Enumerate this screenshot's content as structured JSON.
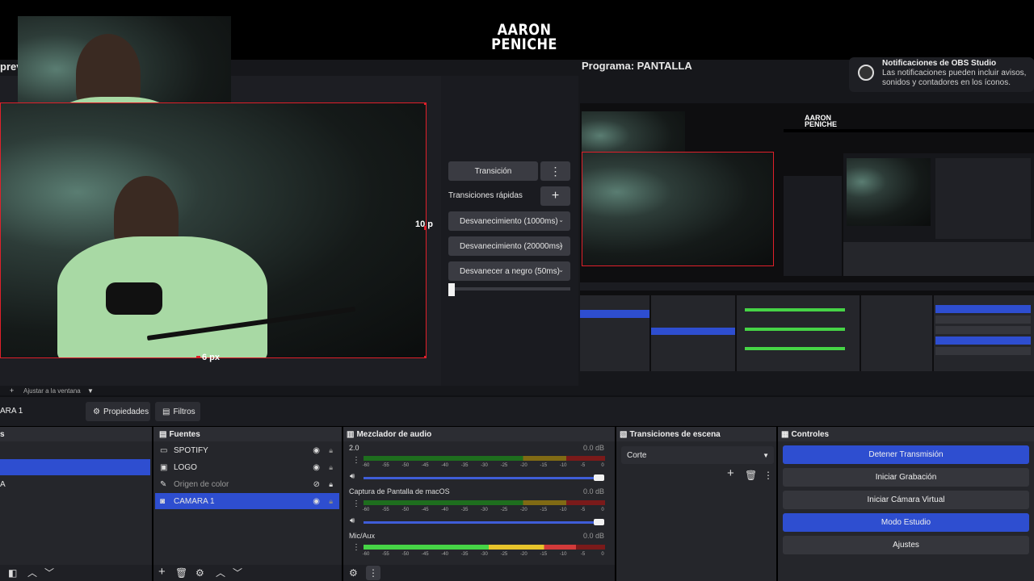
{
  "logo_text": [
    "AARON",
    "PENICHE"
  ],
  "preview": {
    "label": "prev",
    "size_right": "10 p",
    "size_bottom": "6 px",
    "zoom_label": "Ajustar a la ventana"
  },
  "transitions_panel": {
    "transition_button": "Transición",
    "quick_transitions_label": "Transiciones rápidas",
    "quick": [
      "Desvanecimiento (1000ms)",
      "Desvanecimiento (20000ms)",
      "Desvanecer a negro (50ms)"
    ]
  },
  "program": {
    "label": "Programa: PANTALLA"
  },
  "notification": {
    "title": "Notificaciones de OBS Studio",
    "body": "Las notificaciones pueden incluir avisos, sonidos y contadores en los íconos."
  },
  "property_bar": {
    "selected_source": "ARA 1",
    "properties_button": "Propiedades",
    "filters_button": "Filtros"
  },
  "scenes_dock": {
    "title": "s",
    "items": [
      "",
      "A"
    ]
  },
  "sources_dock": {
    "title": "Fuentes",
    "items": [
      {
        "name": "SPOTIFY",
        "icon": "window-icon",
        "selected": false
      },
      {
        "name": "LOGO",
        "icon": "image-icon",
        "selected": false
      },
      {
        "name": "Origen de color",
        "icon": "brush-icon",
        "selected": false
      },
      {
        "name": "CAMARA 1",
        "icon": "camera-icon",
        "selected": true
      }
    ]
  },
  "mixer_dock": {
    "title": "Mezclador de audio",
    "channels": [
      {
        "name": "2.0",
        "db": "0.0 dB",
        "level_pct": 0
      },
      {
        "name": "Captura de Pantalla de macOS",
        "db": "0.0 dB",
        "level_pct": 0
      },
      {
        "name": "Mic/Aux",
        "db": "0.0 dB",
        "level_pct": 88
      }
    ],
    "scale": [
      "-60",
      "-55",
      "-50",
      "-45",
      "-40",
      "-35",
      "-30",
      "-25",
      "-20",
      "-15",
      "-10",
      "-5",
      "0"
    ]
  },
  "scene_transitions_dock": {
    "title": "Transiciones de escena",
    "selected": "Corte"
  },
  "controls_dock": {
    "title": "Controles",
    "buttons": [
      {
        "label": "Detener Transmisión",
        "active": true
      },
      {
        "label": "Iniciar Grabación",
        "active": false
      },
      {
        "label": "Iniciar Cámara Virtual",
        "active": false
      },
      {
        "label": "Modo Estudio",
        "active": true
      },
      {
        "label": "Ajustes",
        "active": false
      }
    ]
  },
  "colors": {
    "accent_blue": "#2e4ed0",
    "selection_red": "#e0202a"
  }
}
